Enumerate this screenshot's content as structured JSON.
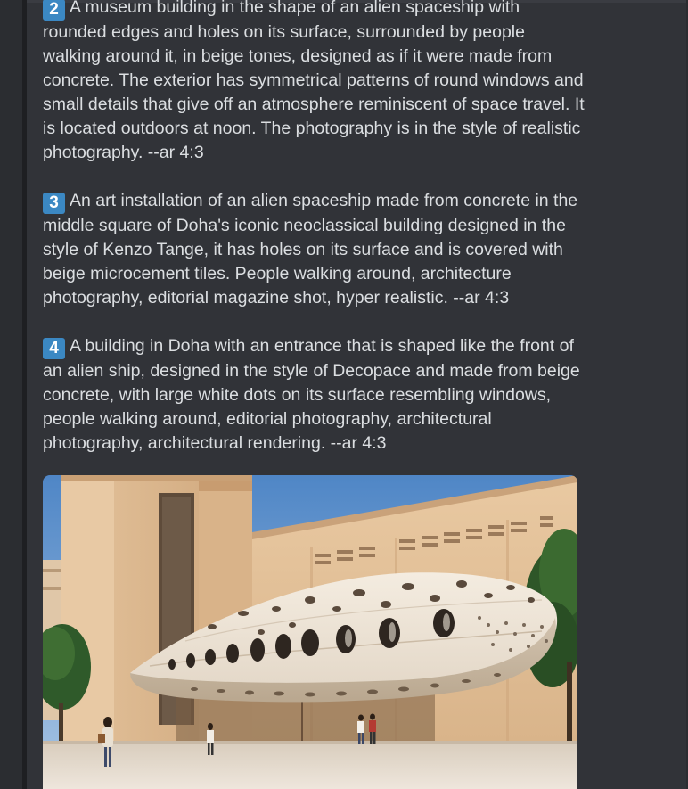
{
  "message": {
    "items": [
      {
        "number": "2",
        "text": "A museum building in the shape of an alien spaceship with rounded edges and holes on its surface, surrounded by people walking around it, in beige tones, designed as if it were made from concrete. The exterior has symmetrical patterns of round windows and small details that give off an atmosphere reminiscent of space travel. It is located outdoors at noon. The photography is in the style of realistic photography. --ar 4:3"
      },
      {
        "number": "3",
        "text": "An art installation of an alien spaceship made from concrete in the middle square of Doha's iconic neoclassical building designed in the style of Kenzo Tange, it has holes on its surface and is covered with beige microcement tiles. People walking around, architecture photography, editorial magazine shot, hyper realistic. --ar 4:3"
      },
      {
        "number": "4",
        "text": "A building in Doha with an entrance that is shaped like the front of an alien ship, designed in the style of Decopace and made from beige concrete, with large white dots on its surface resembling windows, people walking around, editorial photography, architectural photography, architectural rendering. --ar 4:3"
      }
    ]
  },
  "colors": {
    "background": "#313338",
    "text": "#dbdee1",
    "keycap": "#3b88c3"
  }
}
